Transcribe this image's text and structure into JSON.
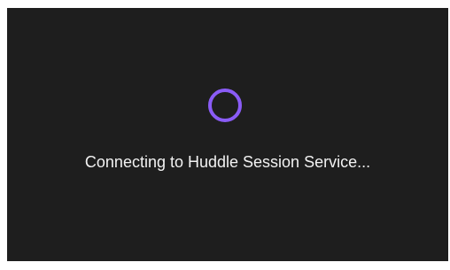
{
  "loading": {
    "status_text": "Connecting to Huddle Session Service...",
    "spinner_icon": "loading-spinner-icon",
    "spinner_color": "#8a5cf6",
    "background_color": "#1e1e1e"
  }
}
